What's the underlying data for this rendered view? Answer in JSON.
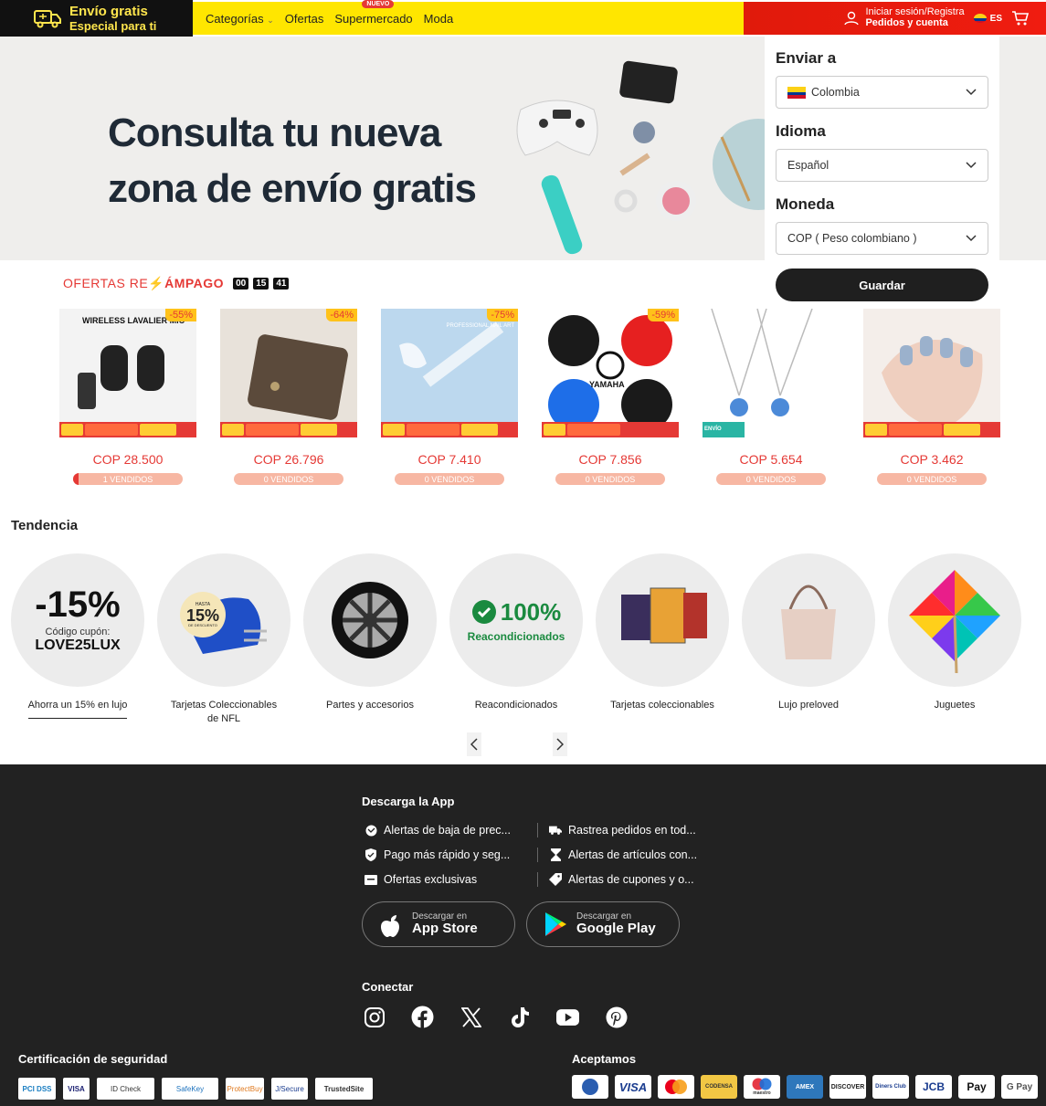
{
  "header": {
    "promo_title": "Envío gratis",
    "promo_sub": "Especial para ti",
    "nav": [
      "Categorías",
      "Ofertas",
      "Supermercado",
      "Moda"
    ],
    "badge_new": "NUEVO",
    "signin_label": "Iniciar sesión/Registra",
    "orders_label": "Pedidos y cuenta",
    "lang_code": "ES",
    "accent_yellow": "#ffe600",
    "accent_red": "#e01a0b"
  },
  "hero": {
    "line1": "Consulta tu nueva",
    "line2": "zona de envío gratis"
  },
  "settings": {
    "ship_to_label": "Enviar a",
    "ship_to_value": "Colombia",
    "language_label": "Idioma",
    "language_value": "Español",
    "currency_label": "Moneda",
    "currency_value": "COP ( Peso colombiano )",
    "save_label": "Guardar"
  },
  "flash": {
    "title_prefix": "OFERTAS RE",
    "title_suffix": "ÁMPAGO",
    "timer": [
      "00",
      "15",
      "41"
    ],
    "products": [
      {
        "image_text": "WIRELESS LAVALIER MIC",
        "discount": "-55%",
        "price": "COP 28.500",
        "sold": "1 VENDIDOS",
        "sold_fraction": 0.05
      },
      {
        "image_text": "",
        "discount": "-64%",
        "price": "COP 26.796",
        "sold": "0 VENDIDOS",
        "sold_fraction": 0
      },
      {
        "image_text": "PROFESSIONAL NAIL ART",
        "discount": "-75%",
        "price": "COP 7.410",
        "sold": "0 VENDIDOS",
        "sold_fraction": 0
      },
      {
        "image_text": "YAMAHA",
        "discount": "-59%",
        "price": "COP 7.856",
        "sold": "0 VENDIDOS",
        "sold_fraction": 0
      },
      {
        "image_text": "ENVÍO GRATIS",
        "discount": "",
        "price": "COP 5.654",
        "sold": "0 VENDIDOS",
        "sold_fraction": 0
      },
      {
        "image_text": "",
        "discount": "",
        "price": "COP 3.462",
        "sold": "0 VENDIDOS",
        "sold_fraction": 0
      }
    ]
  },
  "trending": {
    "title": "Tendencia",
    "items": [
      {
        "label": "Ahorra un 15% en lujo",
        "big": "-15%",
        "sub": "Código cupón:",
        "code": "LOVE25LUX"
      },
      {
        "label": "Tarjetas Coleccionables de NFL",
        "badge": "15%",
        "badge_top": "HASTA",
        "badge_bottom": "DE DESCUENTO"
      },
      {
        "label": "Partes y accesorios"
      },
      {
        "label": "Reacondicionados",
        "big": "100%",
        "sub": "Reacondicionados"
      },
      {
        "label": "Tarjetas coleccionables"
      },
      {
        "label": "Lujo preloved"
      },
      {
        "label": "Juguetes"
      }
    ]
  },
  "footer": {
    "download_title": "Descarga la App",
    "features_left": [
      "Alertas de baja de prec...",
      "Pago más rápido y seg...",
      "Ofertas exclusivas"
    ],
    "features_right": [
      "Rastrea pedidos en tod...",
      "Alertas de artículos con...",
      "Alertas de cupones y o..."
    ],
    "appstore_small": "Descargar en",
    "appstore_big": "App Store",
    "googleplay_small": "Descargar en",
    "googleplay_big": "Google Play",
    "connect_title": "Conectar",
    "security_title": "Certificación de seguridad",
    "accept_title": "Aceptamos",
    "certs": [
      "PCI DSS",
      "VISA",
      "ID Check",
      "SafeKey",
      "ProtectBuy",
      "J/Secure",
      "TrustedSite"
    ],
    "payments": [
      "",
      "VISA",
      "",
      "CODENSA",
      "maestro",
      "AMEX",
      "DISCOVER",
      "Diners Club",
      "JCB",
      "Pay",
      "G Pay"
    ]
  }
}
